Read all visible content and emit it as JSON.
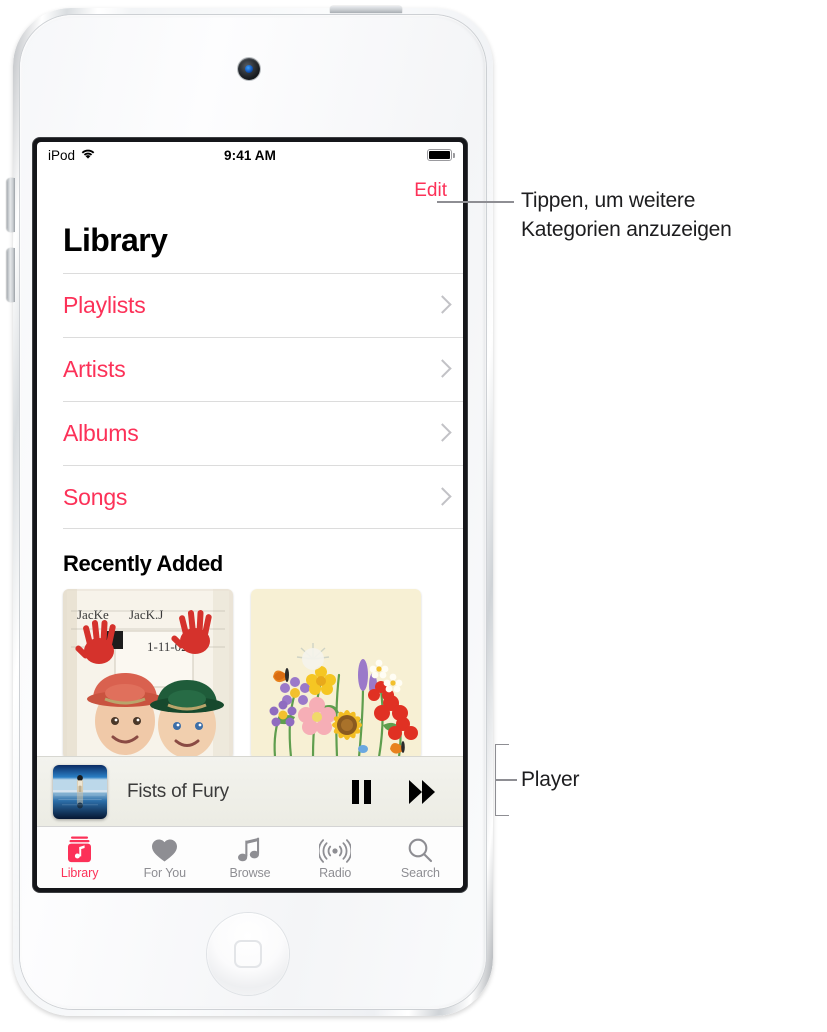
{
  "device": {
    "name": "iPod touch"
  },
  "status_bar": {
    "carrier": "iPod",
    "wifi_icon": "wifi-icon",
    "time": "9:41 AM",
    "battery_icon": "battery-full-icon"
  },
  "nav": {
    "edit_label": "Edit"
  },
  "screen": {
    "page_title": "Library",
    "categories": [
      {
        "label": "Playlists",
        "chevron": "chevron-right-icon"
      },
      {
        "label": "Artists",
        "chevron": "chevron-right-icon"
      },
      {
        "label": "Albums",
        "chevron": "chevron-right-icon"
      },
      {
        "label": "Songs",
        "chevron": "chevron-right-icon"
      }
    ],
    "recently_added": {
      "title": "Recently Added",
      "items": [
        {
          "name": "album-art-kids-handprints",
          "caption_text": "JacKe  JacK.J",
          "caption_date": "1-11-02"
        },
        {
          "name": "album-art-wildflowers"
        }
      ]
    }
  },
  "player": {
    "artwork_name": "now-playing-artwork",
    "track_title": "Fists of Fury",
    "pause_label": "pause-icon",
    "next_label": "fast-forward-icon"
  },
  "tabbar": {
    "tabs": [
      {
        "label": "Library",
        "icon": "library-icon",
        "active": true
      },
      {
        "label": "For You",
        "icon": "heart-icon",
        "active": false
      },
      {
        "label": "Browse",
        "icon": "music-note-icon",
        "active": false
      },
      {
        "label": "Radio",
        "icon": "radio-waves-icon",
        "active": false
      },
      {
        "label": "Search",
        "icon": "search-icon",
        "active": false
      }
    ]
  },
  "callouts": {
    "edit": {
      "line1": "Tippen, um weitere",
      "line2": "Kategorien anzuzeigen"
    },
    "player": {
      "label": "Player"
    }
  },
  "colors": {
    "accent": "#fc3158",
    "inactive": "#8e8e93",
    "text": "#1d1d1f"
  }
}
